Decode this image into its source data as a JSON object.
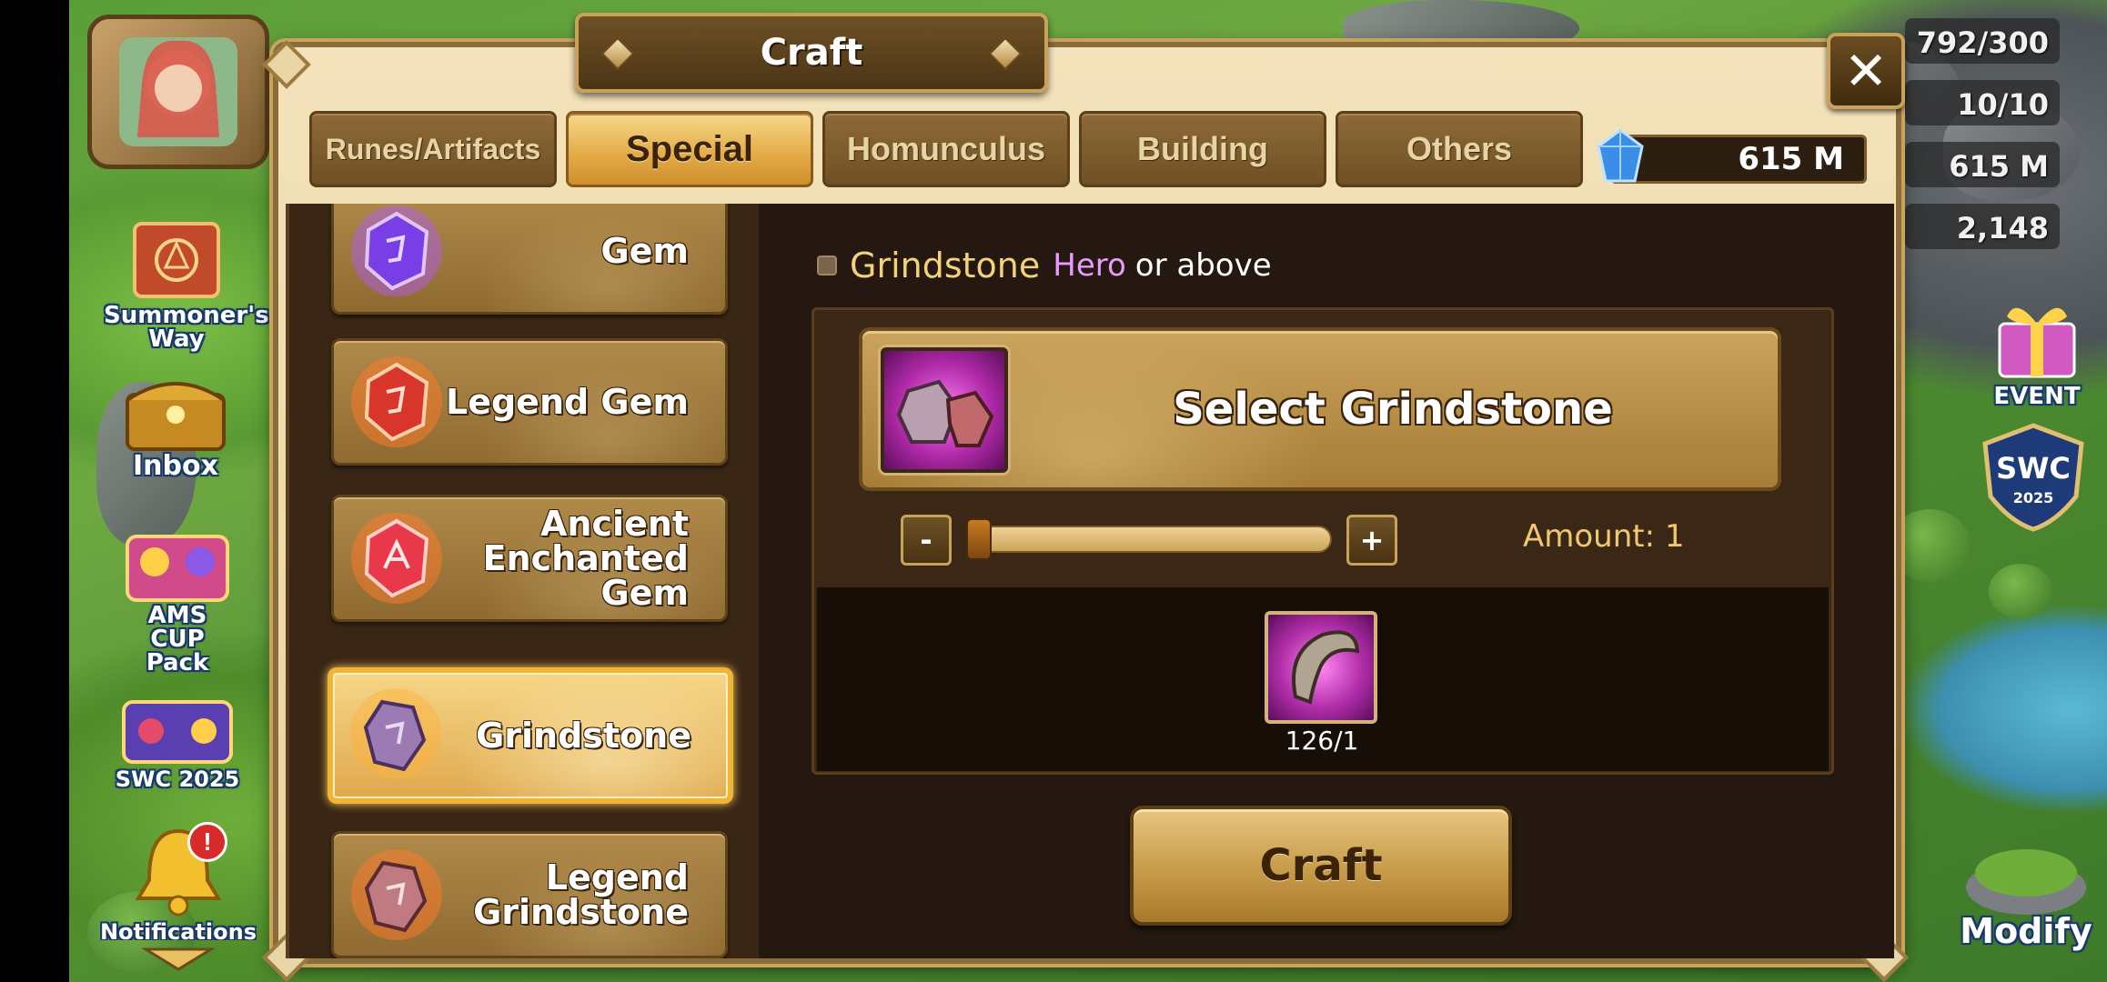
{
  "left_menu": {
    "summoners_way": "Summoner's Way",
    "inbox": "Inbox",
    "ams_cup_pack": "AMS CUP Pack",
    "swc_2025": "SWC 2025",
    "notifications": "Notifications",
    "notification_badge": "!"
  },
  "hud": {
    "res1": "792/300",
    "res2": "10/10",
    "res3": "615 M",
    "res4": "2,148",
    "event_label": "EVENT",
    "swc_badge_title": "SWC",
    "swc_badge_year": "2025",
    "modify_label": "Modify"
  },
  "dialog": {
    "title": "Craft",
    "close_glyph": "✕",
    "tabs": [
      {
        "label": "Runes/Artifacts",
        "active": false
      },
      {
        "label": "Special",
        "active": true
      },
      {
        "label": "Homunculus",
        "active": false
      },
      {
        "label": "Building",
        "active": false
      },
      {
        "label": "Others",
        "active": false
      }
    ],
    "currency": "615 M"
  },
  "items": [
    {
      "label": "Gem",
      "icon": "gem-icon",
      "selected": false
    },
    {
      "label": "Legend Gem",
      "icon": "legend-gem-icon",
      "selected": false
    },
    {
      "label": "Ancient\nEnchanted\nGem",
      "icon": "ancient-enchanted-gem-icon",
      "selected": false
    },
    {
      "label": "Grindstone",
      "icon": "grindstone-icon",
      "selected": true
    },
    {
      "label": "Legend\nGrindstone",
      "icon": "legend-grindstone-icon",
      "selected": false
    }
  ],
  "detail": {
    "filter_name": "Grindstone",
    "filter_grade": "Hero",
    "filter_tail": "or above",
    "select_label": "Select Grindstone",
    "minus": "-",
    "plus": "+",
    "amount": "Amount: 1",
    "amount_fraction": 0.0,
    "material_count": "126/1",
    "craft_label": "Craft"
  },
  "colors": {
    "frame": "#8a6b3a",
    "active_tab": "#e3aa45",
    "hero_purple": "#e69cff",
    "amount_gold": "#f1c86e"
  }
}
